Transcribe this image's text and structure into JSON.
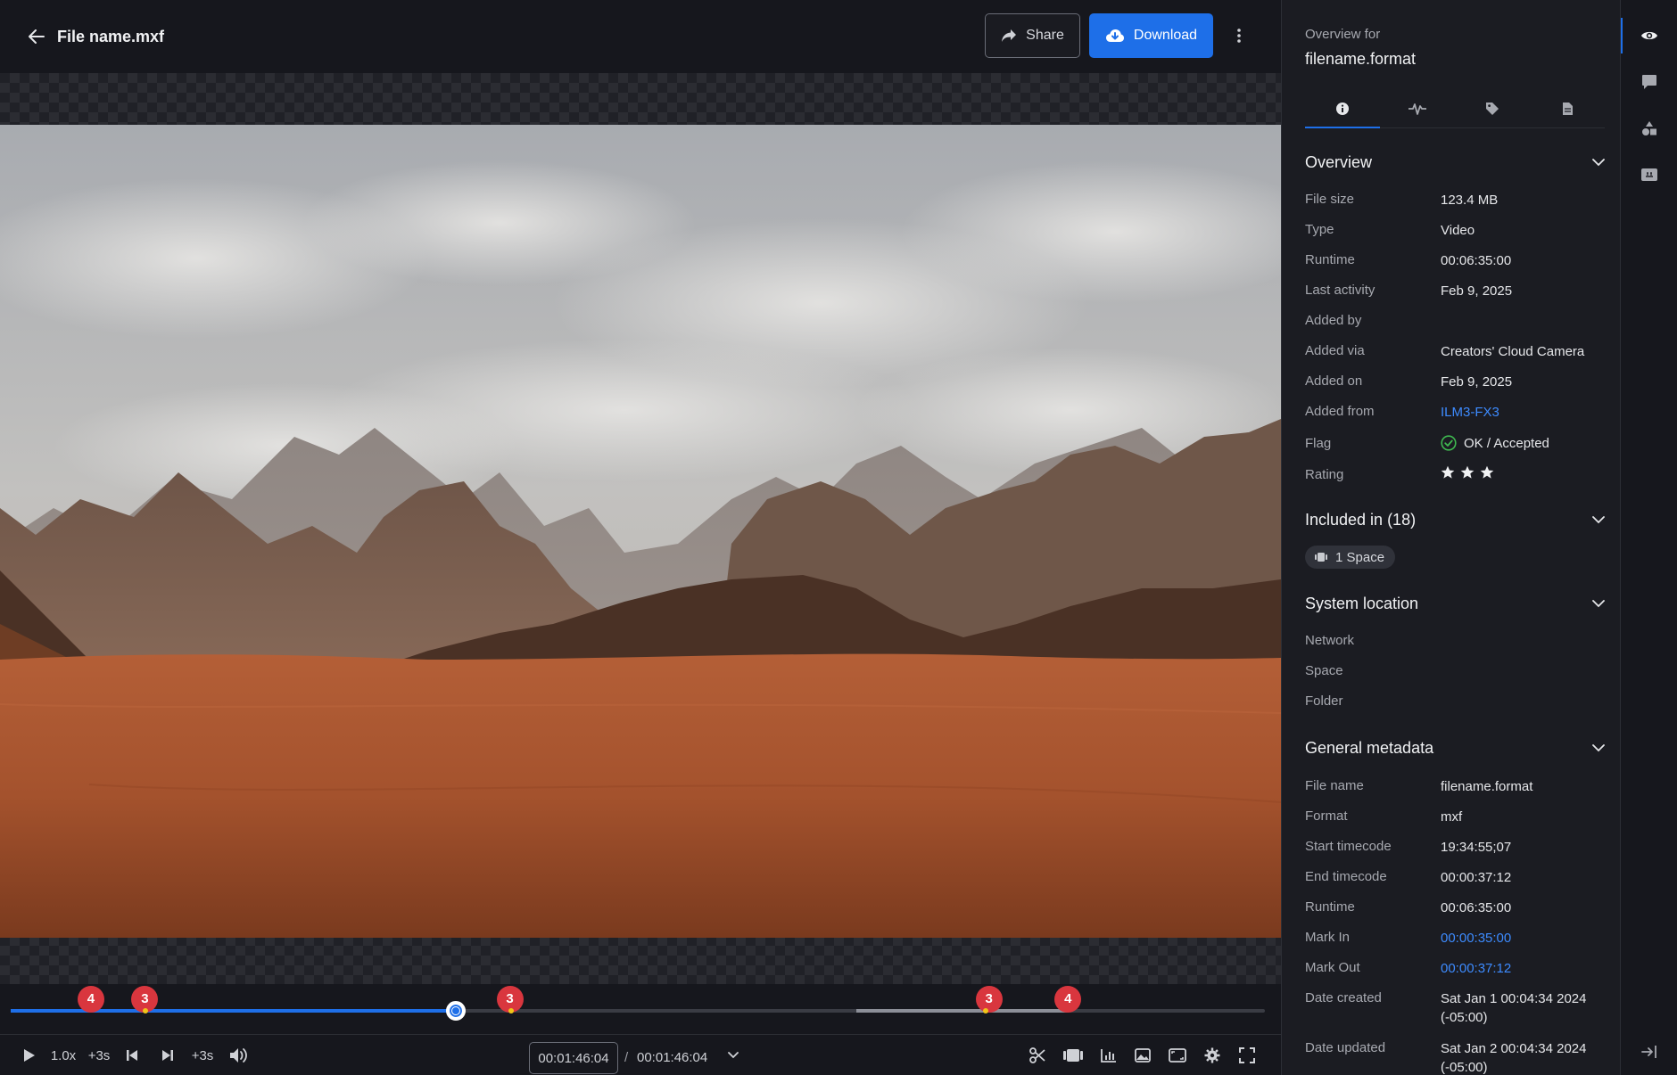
{
  "header": {
    "title": "File name.mxf",
    "share_label": "Share",
    "download_label": "Download",
    "accent": "#1e6fe8"
  },
  "timeline": {
    "progress_fraction": 0.355,
    "markers": [
      {
        "label": "4",
        "position_fraction": 0.064
      },
      {
        "label": "3",
        "position_fraction": 0.107
      },
      {
        "label": "3",
        "position_fraction": 0.398
      },
      {
        "label": "3",
        "position_fraction": 0.78
      },
      {
        "label": "4",
        "position_fraction": 0.843
      }
    ],
    "marker_color": "#d9363e"
  },
  "controls": {
    "speed": "1.0x",
    "skip_back": "+3s",
    "skip_fwd": "+3s",
    "current_time": "00:01:46:04",
    "separator": "/",
    "total_time": "00:01:46:04"
  },
  "panel": {
    "overview_for": "Overview for",
    "filename": "filename.format",
    "overview": {
      "title": "Overview",
      "rows": [
        {
          "label": "File size",
          "value": "123.4 MB"
        },
        {
          "label": "Type",
          "value": "Video"
        },
        {
          "label": "Runtime",
          "value": "00:06:35:00"
        },
        {
          "label": "Last activity",
          "value": "Feb 9, 2025"
        },
        {
          "label": "Added by",
          "value": ""
        },
        {
          "label": "Added via",
          "value": "Creators' Cloud Camera"
        },
        {
          "label": "Added on",
          "value": "Feb 9, 2025"
        },
        {
          "label": "Added from",
          "value": "ILM3-FX3"
        },
        {
          "label": "Flag",
          "value": "OK / Accepted"
        },
        {
          "label": "Rating",
          "value": 3
        }
      ]
    },
    "included": {
      "title": "Included in (18)",
      "chip": "1 Space"
    },
    "system_location": {
      "title": "System location",
      "rows": [
        "Network",
        "Space",
        "Folder"
      ]
    },
    "general_metadata": {
      "title": "General metadata",
      "rows": [
        {
          "label": "File name",
          "value": "filename.format"
        },
        {
          "label": "Format",
          "value": "mxf"
        },
        {
          "label": "Start timecode",
          "value": "19:34:55;07"
        },
        {
          "label": "End timecode",
          "value": "00:00:37:12"
        },
        {
          "label": "Runtime",
          "value": "00:06:35:00"
        },
        {
          "label": "Mark In",
          "value": "00:00:35:00"
        },
        {
          "label": "Mark Out",
          "value": "00:00:37:12"
        },
        {
          "label": "Date created",
          "value": "Sat Jan 1 00:04:34 2024",
          "value2": "(-05:00)"
        },
        {
          "label": "Date updated",
          "value": "Sat Jan 2 00:04:34 2024",
          "value2": "(-05:00)"
        }
      ]
    }
  },
  "icons": {
    "rail": [
      "eye-icon",
      "comment-icon",
      "shapes-icon",
      "subtitles-icon",
      "collapse-panel-icon"
    ],
    "tabs": [
      "info-icon",
      "waveform-icon",
      "tag-icon",
      "document-icon"
    ]
  }
}
